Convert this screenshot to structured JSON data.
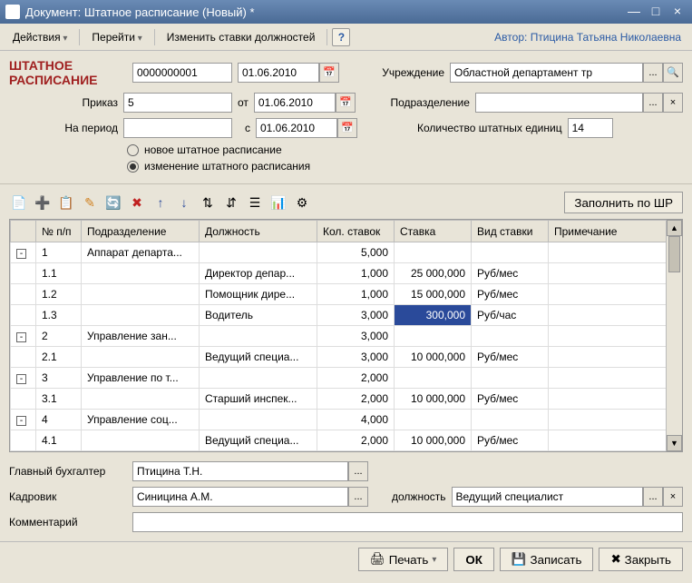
{
  "title": "Документ: Штатное расписание (Новый) *",
  "menu": {
    "actions": "Действия",
    "goto": "Перейти",
    "change_rates": "Изменить ставки должностей",
    "help": "?"
  },
  "author_label": "Автор:",
  "author": "Птицина Татьяна Николаевна",
  "red_title_1": "ШТАТНОЕ",
  "red_title_2": "РАСПИСАНИЕ",
  "fields": {
    "doc_number": "0000000001",
    "doc_date": "01.06.2010",
    "org_label": "Учреждение",
    "org_value": "Областной департамент тр",
    "order_label": "Приказ",
    "order_number": "5",
    "order_from_label": "от",
    "order_date": "01.06.2010",
    "dept_label": "Подразделение",
    "dept_value": "",
    "period_label": "На период",
    "period_value": "",
    "period_from_label": "с",
    "period_date": "01.06.2010",
    "units_label": "Количество штатных единиц",
    "units_value": "14",
    "radio1": "новое штатное расписание",
    "radio2": "изменение штатного расписания"
  },
  "fill_button": "Заполнить по ШР",
  "columns": [
    "№ п/п",
    "Подразделение",
    "Должность",
    "Кол. ставок",
    "Ставка",
    "Вид ставки",
    "Примечание"
  ],
  "rows": [
    {
      "tree": "-",
      "num": "1",
      "dept": "Аппарат департа...",
      "pos": "",
      "count": "5,000",
      "rate": "",
      "type": "",
      "note": ""
    },
    {
      "tree": "",
      "num": "1.1",
      "dept": "",
      "pos": "Директор депар...",
      "count": "1,000",
      "rate": "25 000,000",
      "type": "Руб/мес",
      "note": ""
    },
    {
      "tree": "",
      "num": "1.2",
      "dept": "",
      "pos": "Помощник дире...",
      "count": "1,000",
      "rate": "15 000,000",
      "type": "Руб/мес",
      "note": ""
    },
    {
      "tree": "",
      "num": "1.3",
      "dept": "",
      "pos": "Водитель",
      "count": "3,000",
      "rate": "300,000",
      "type": "Руб/час",
      "note": "",
      "selected": true
    },
    {
      "tree": "-",
      "num": "2",
      "dept": "Управление зан...",
      "pos": "",
      "count": "3,000",
      "rate": "",
      "type": "",
      "note": ""
    },
    {
      "tree": "",
      "num": "2.1",
      "dept": "",
      "pos": "Ведущий специа...",
      "count": "3,000",
      "rate": "10 000,000",
      "type": "Руб/мес",
      "note": ""
    },
    {
      "tree": "-",
      "num": "3",
      "dept": "Управление по т...",
      "pos": "",
      "count": "2,000",
      "rate": "",
      "type": "",
      "note": ""
    },
    {
      "tree": "",
      "num": "3.1",
      "dept": "",
      "pos": "Старший инспек...",
      "count": "2,000",
      "rate": "10 000,000",
      "type": "Руб/мес",
      "note": ""
    },
    {
      "tree": "-",
      "num": "4",
      "dept": "Управление соц...",
      "pos": "",
      "count": "4,000",
      "rate": "",
      "type": "",
      "note": ""
    },
    {
      "tree": "",
      "num": "4.1",
      "dept": "",
      "pos": "Ведущий специа...",
      "count": "2,000",
      "rate": "10 000,000",
      "type": "Руб/мес",
      "note": ""
    }
  ],
  "footer": {
    "chief_acc_label": "Главный бухгалтер",
    "chief_acc": "Птицина Т.Н.",
    "hr_label": "Кадровик",
    "hr": "Синицина А.М.",
    "position_label": "должность",
    "position": "Ведущий специалист",
    "comment_label": "Комментарий",
    "comment": ""
  },
  "buttons": {
    "print": "Печать",
    "ok": "ОК",
    "save": "Записать",
    "close": "Закрыть"
  },
  "icons": {
    "calendar": "📅",
    "dots": "...",
    "x": "×",
    "search": "🔍",
    "print": "🖨",
    "save": "💾",
    "close": "✖"
  }
}
